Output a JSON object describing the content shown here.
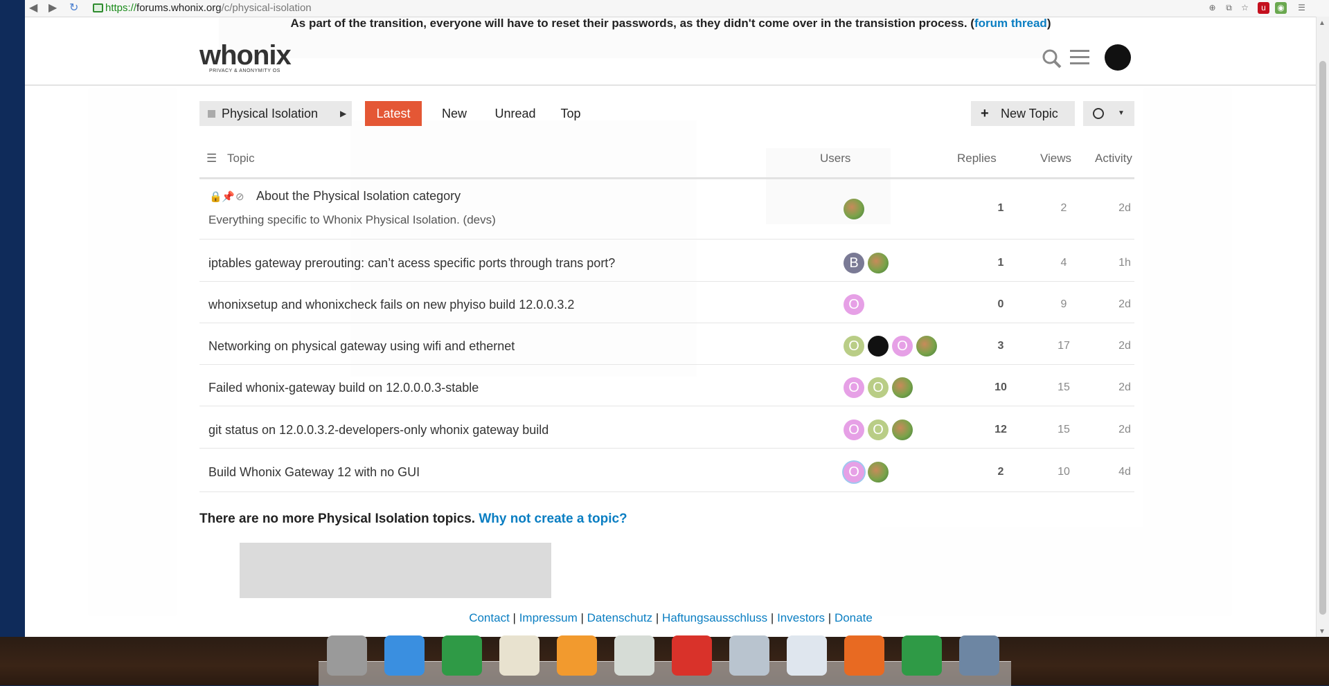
{
  "browser": {
    "url_scheme": "https://",
    "url_host": "forums.whonix.org",
    "url_path": "/c/physical-isolation",
    "nav": {
      "back": "◀",
      "forward": "▶",
      "reload": "↻"
    },
    "ext_icons": [
      "zoom-icon",
      "translate-icon",
      "star-icon",
      "ublock-icon",
      "extension-icon",
      "menu-icon"
    ]
  },
  "banner": {
    "text": "As part of the transition, everyone will have to reset their passwords, as they didn't come over in the transistion process. (",
    "link": "forum thread",
    "close": ")"
  },
  "header": {
    "logo_text": "whonix",
    "logo_sub": "PRIVACY & ANONYMITY OS"
  },
  "nav": {
    "category": "Physical Isolation",
    "tabs": [
      "Latest",
      "New",
      "Unread",
      "Top"
    ],
    "active_tab": "Latest",
    "new_topic": "New Topic"
  },
  "table": {
    "headers": {
      "topic": "Topic",
      "users": "Users",
      "replies": "Replies",
      "views": "Views",
      "activity": "Activity"
    },
    "rows": [
      {
        "title": "About the Physical Isolation category",
        "excerpt": "Everything specific to Whonix Physical Isolation. (devs)",
        "replies": "1",
        "views": "2",
        "activity": "2d",
        "avatars": [
          {
            "kind": "green",
            "letter": ""
          }
        ]
      },
      {
        "title": "iptables gateway prerouting: can’t acess specific ports through trans port?",
        "replies": "1",
        "views": "4",
        "activity": "1h",
        "avatars": [
          {
            "kind": "gray",
            "letter": "B"
          },
          {
            "kind": "green",
            "letter": ""
          }
        ]
      },
      {
        "title": "whonixsetup and whonixcheck fails on new phyiso build 12.0.0.3.2",
        "replies": "0",
        "views": "9",
        "activity": "2d",
        "avatars": [
          {
            "kind": "purple",
            "letter": "O"
          }
        ]
      },
      {
        "title": "Networking on physical gateway using wifi and ethernet",
        "replies": "3",
        "views": "17",
        "activity": "2d",
        "avatars": [
          {
            "kind": "olive",
            "letter": "O"
          },
          {
            "kind": "black",
            "letter": ""
          },
          {
            "kind": "purple",
            "letter": "O"
          },
          {
            "kind": "green",
            "letter": ""
          }
        ]
      },
      {
        "title": "Failed whonix-gateway build on 12.0.0.0.3-stable",
        "replies": "10",
        "views": "15",
        "activity": "2d",
        "avatars": [
          {
            "kind": "purple",
            "letter": "O"
          },
          {
            "kind": "olive",
            "letter": "O"
          },
          {
            "kind": "green",
            "letter": ""
          }
        ]
      },
      {
        "title": "git status on 12.0.0.3.2-developers-only whonix gateway build",
        "replies": "12",
        "views": "15",
        "activity": "2d",
        "avatars": [
          {
            "kind": "purple",
            "letter": "O"
          },
          {
            "kind": "olive",
            "letter": "O"
          },
          {
            "kind": "green",
            "letter": ""
          }
        ]
      },
      {
        "title": "Build Whonix Gateway 12 with no GUI",
        "replies": "2",
        "views": "10",
        "activity": "4d",
        "avatars": [
          {
            "kind": "purple ring",
            "letter": "O"
          },
          {
            "kind": "green",
            "letter": ""
          }
        ]
      }
    ]
  },
  "footer": {
    "no_more_text": "There are no more Physical Isolation topics.",
    "no_more_link": "Why not create a topic?",
    "links": [
      "Contact",
      "Impressum",
      "Datenschutz",
      "Haftungsausschluss",
      "Investors",
      "Donate"
    ],
    "separator": "|"
  },
  "dock": {
    "apps": [
      {
        "name": "home-folder-icon",
        "color": "#9a9a9a"
      },
      {
        "name": "workspaces-icon",
        "color": "#3a8fe0"
      },
      {
        "name": "chrome-icon",
        "color": "#2f9a46"
      },
      {
        "name": "mail-icon",
        "color": "#e8e2cf"
      },
      {
        "name": "music-icon",
        "color": "#f29a2e"
      },
      {
        "name": "calendar-icon",
        "color": "#d6dcd6"
      },
      {
        "name": "video-icon",
        "color": "#d9322a"
      },
      {
        "name": "photos-icon",
        "color": "#b9c4cf"
      },
      {
        "name": "settings-toggle-icon",
        "color": "#dfe6ee"
      },
      {
        "name": "app-center-icon",
        "color": "#e86a22"
      },
      {
        "name": "chrome-2-icon",
        "color": "#2f9a46"
      },
      {
        "name": "virtualbox-icon",
        "color": "#6d86a3"
      }
    ]
  },
  "colors": {
    "accent": "#e45735",
    "link": "#0a7ec2"
  }
}
